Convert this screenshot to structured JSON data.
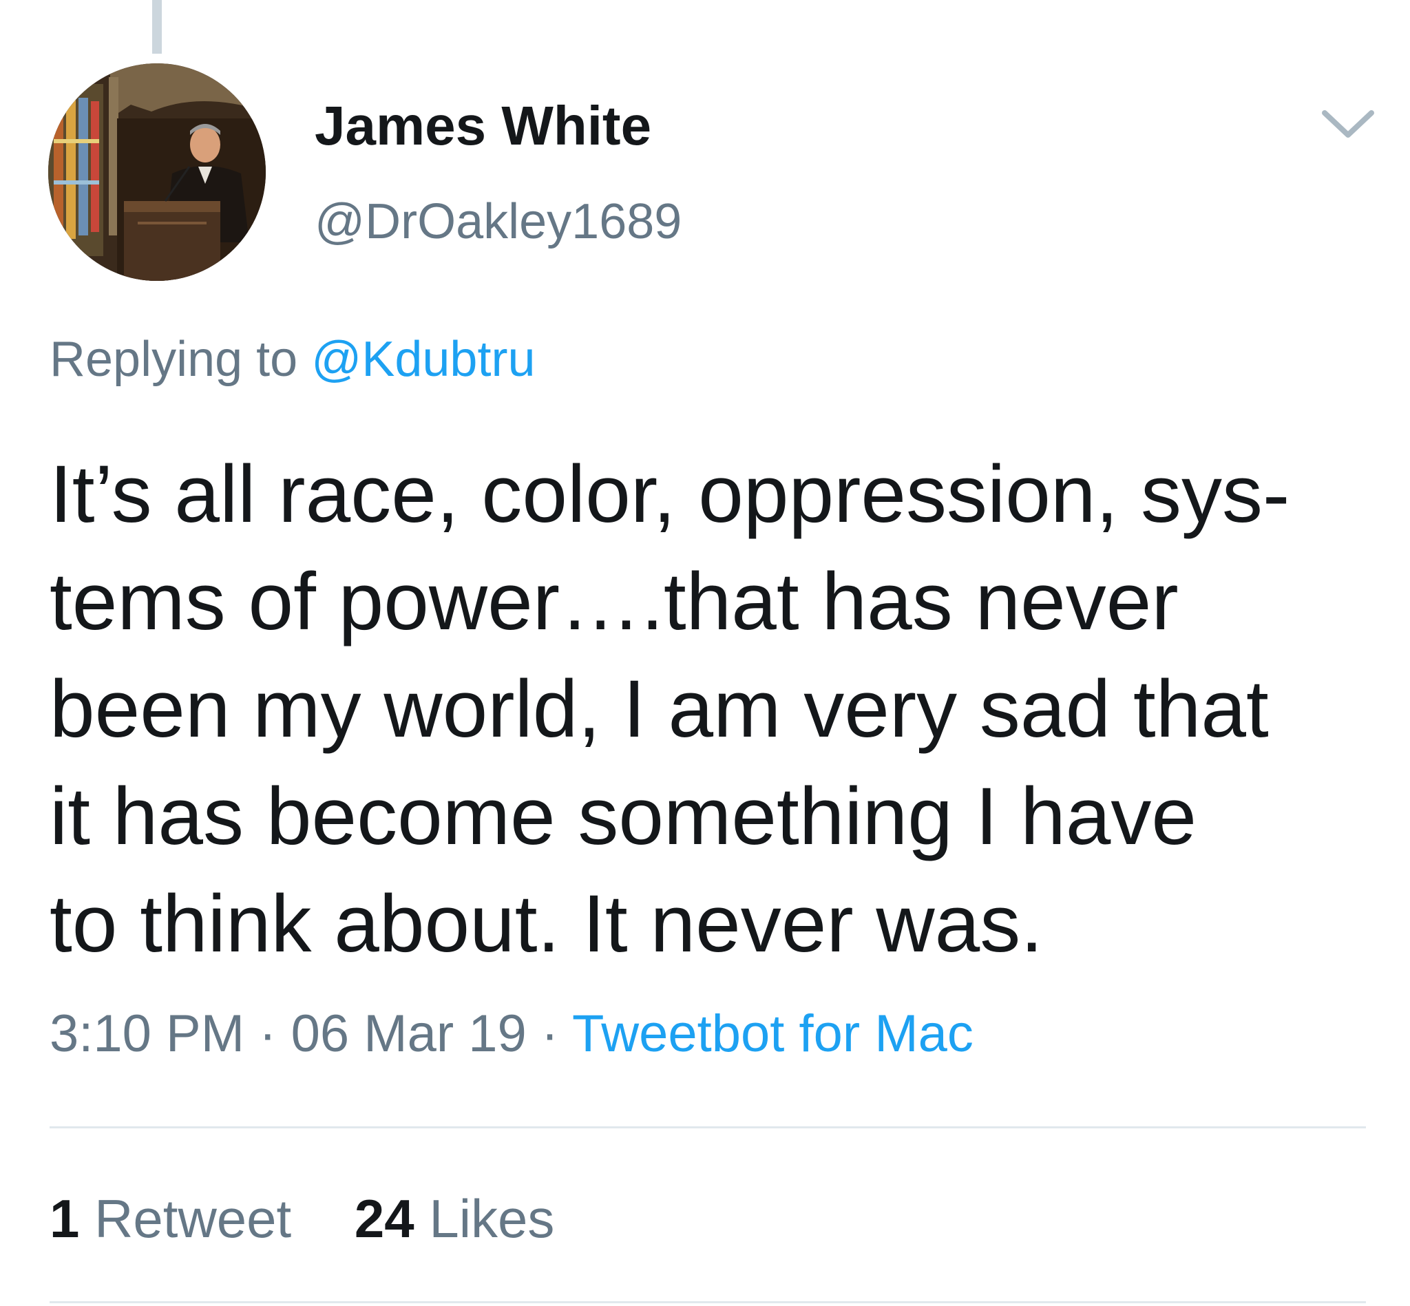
{
  "tweet": {
    "author_name": "James White",
    "author_handle": "@DrOakley1689",
    "reply_prefix": "Replying to",
    "reply_to": "@Kdubtru",
    "text_lines": [
      "It’s all race, color, oppression, sys-",
      "tems of power….that has never",
      "been my world, I am very sad that",
      "it has become something I have",
      "to think about. It never was."
    ],
    "time": "3:10 PM",
    "date": "06 Mar 19",
    "separator": "·",
    "source": "Tweetbot for Mac"
  },
  "stats": {
    "retweets_count": "1",
    "retweets_label": "Retweet",
    "likes_count": "24",
    "likes_label": "Likes"
  },
  "icons": {
    "more_menu": "chevron-down-icon"
  },
  "colors": {
    "text_primary": "#14171a",
    "text_secondary": "#657786",
    "link_blue": "#1da1f2",
    "divider": "#e1e8ed",
    "thread_line": "#ccd6dd"
  }
}
